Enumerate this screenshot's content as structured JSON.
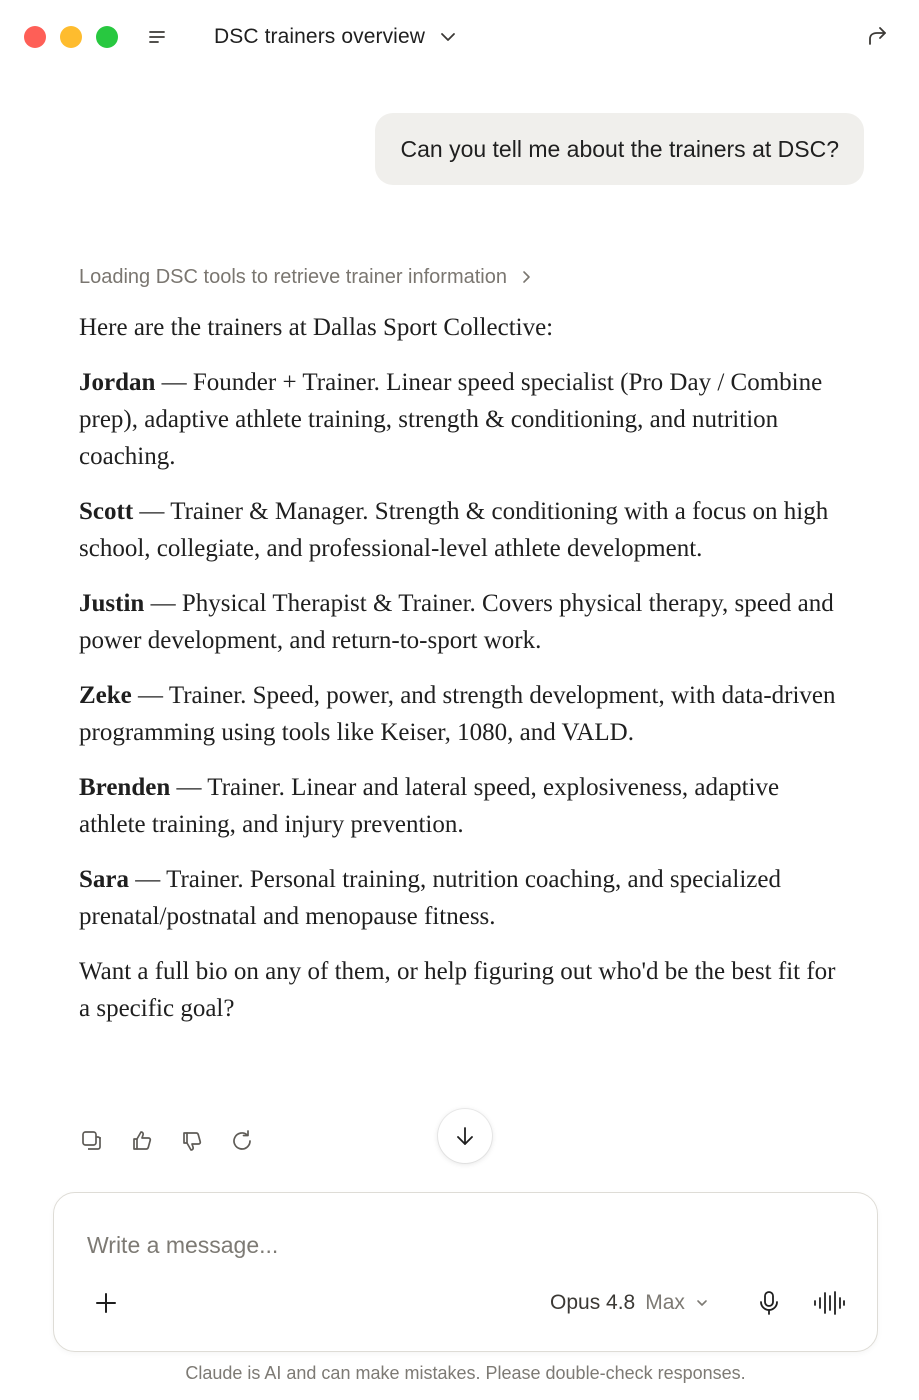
{
  "header": {
    "title": "DSC trainers overview"
  },
  "user_message": "Can you tell me about the trainers at DSC?",
  "assistant": {
    "tool_status": "Loading DSC tools to retrieve trainer information",
    "intro": "Here are the trainers at Dallas Sport Collective:",
    "trainers": [
      {
        "name": "Jordan",
        "sep": " — ",
        "desc": "Founder + Trainer. Linear speed specialist (Pro Day / Combine prep), adaptive athlete training, strength & conditioning, and nutrition coaching."
      },
      {
        "name": "Scott",
        "sep": " — ",
        "desc": "Trainer & Manager. Strength & conditioning with a focus on high school, collegiate, and professional-level athlete development."
      },
      {
        "name": "Justin",
        "sep": " — ",
        "desc": "Physical Therapist & Trainer. Covers physical therapy, speed and power development, and return-to-sport work."
      },
      {
        "name": "Zeke",
        "sep": " — ",
        "desc": "Trainer. Speed, power, and strength development, with data-driven programming using tools like Keiser, 1080, and VALD."
      },
      {
        "name": "Brenden",
        "sep": " — ",
        "desc": "Trainer. Linear and lateral speed, explosiveness, adaptive athlete training, and injury prevention."
      },
      {
        "name": "Sara",
        "sep": " — ",
        "desc": "Trainer. Personal training, nutrition coaching, and specialized prenatal/postnatal and menopause fitness."
      }
    ],
    "closing": "Want a full bio on any of them, or help figuring out who'd be the best fit for a specific goal?"
  },
  "action_icons": [
    "copy-icon",
    "thumbs-up-icon",
    "thumbs-down-icon",
    "retry-icon"
  ],
  "composer": {
    "placeholder": "Write a message...",
    "model_name": "Opus 4.8",
    "model_mode": "Max"
  },
  "disclaimer": "Claude is AI and can make mistakes. Please double-check responses.",
  "colors": {
    "traffic_red": "#fe5f57",
    "traffic_yellow": "#febc2e",
    "traffic_green": "#28c840",
    "user_bubble": "#f0efec",
    "muted_text": "#7d7a74"
  }
}
